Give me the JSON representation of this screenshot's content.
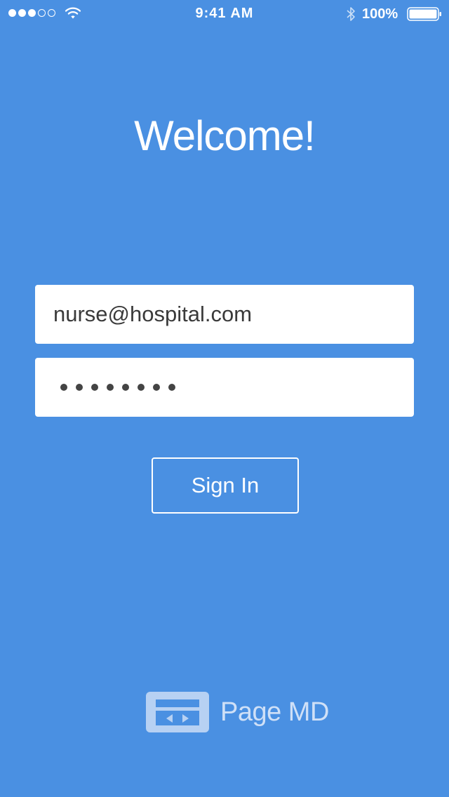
{
  "status_bar": {
    "time": "9:41 AM",
    "battery_percent": "100%",
    "signal_bars_filled": 3,
    "signal_bars_total": 5,
    "icons": [
      "signal-icon",
      "wifi-icon",
      "bluetooth-icon",
      "battery-icon"
    ]
  },
  "login": {
    "title": "Welcome!",
    "email_value": "nurse@hospital.com",
    "password_masked_length": 8,
    "sign_in_label": "Sign In"
  },
  "brand": {
    "name": "Page MD",
    "icon": "pager-icon"
  },
  "colors": {
    "background": "#4a90e2",
    "field_background": "#ffffff",
    "text_on_field": "#3a3a3a",
    "brand_text": "#cfe0f7"
  }
}
